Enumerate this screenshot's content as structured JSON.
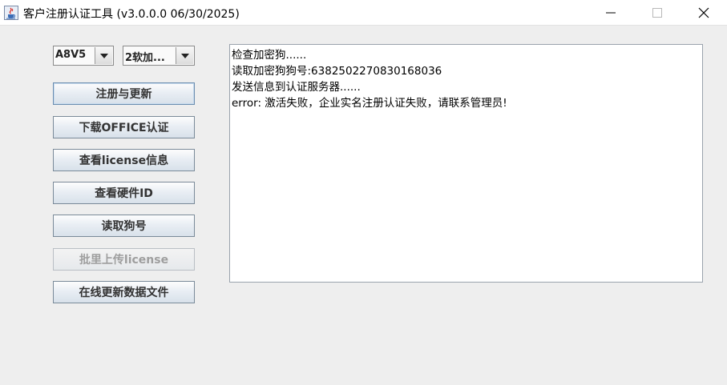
{
  "window": {
    "title": "客户注册认证工具  (v3.0.0.0 06/30/2025)",
    "icon": "java-cup-icon"
  },
  "controls": {
    "version_select": "A8V5",
    "type_select": "2软加..."
  },
  "buttons": {
    "register_update": "注册与更新",
    "download_office": "下载OFFICE认证",
    "view_license": "查看license信息",
    "view_hardware_id": "查看硬件ID",
    "read_dongle": "读取狗号",
    "batch_upload_license": "批里上传license",
    "online_update_data": "在线更新数据文件"
  },
  "output": {
    "lines": [
      "检查加密狗......",
      "读取加密狗狗号:6382502270830168036",
      "发送信息到认证服务器......",
      "error: 激活失败，企业实名注册认证失败，请联系管理员!"
    ]
  }
}
